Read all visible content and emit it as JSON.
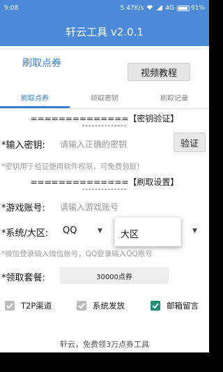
{
  "status_bar": {
    "time": "9:08",
    "speed": "5.47K/s",
    "network": "4G",
    "battery": "91%",
    "icons": [
      "wifi-icon",
      "signal-icon",
      "battery-icon"
    ]
  },
  "app_title": "轩云工具 v2.0.1",
  "top": {
    "title": "刷取点券",
    "tutorial_button": "视频教程"
  },
  "tabs": [
    {
      "label": "刷取点券",
      "active": true
    },
    {
      "label": "领取密钥",
      "active": false
    },
    {
      "label": "刷取记录",
      "active": false
    }
  ],
  "key_section": {
    "header": "==============【密钥验证】",
    "dashes": "--------------",
    "key_label": "*输入密钥:",
    "key_placeholder": "请输入正确的密钥",
    "verify_button": "验证",
    "hint": "*密钥用于验证使用软件权限，可免费领取!"
  },
  "settings_section": {
    "header": "==============【刷取设置】",
    "dashes": "--------------",
    "account_label": "*游戏账号:",
    "account_placeholder": "请输入游戏账号",
    "system_label": "*系统/大区:",
    "system_value": "QQ",
    "region_value": "大区",
    "hint": "*微信登录输入微信账号，QQ登录输入QQ账号",
    "package_label": "*领取套餐:",
    "package_value": "30000点券"
  },
  "options": [
    {
      "label": "T2P渠道",
      "checked": false
    },
    {
      "label": "系统发放",
      "checked": false
    },
    {
      "label": "邮箱留言",
      "checked": true
    }
  ],
  "footer": "轩云，免费领3万点券工具",
  "colors": {
    "primary": "#4a8ad8",
    "accent": "#3a80d8",
    "checkbox_on": "#1f8d78",
    "checkbox_off": "#bdbdbd"
  }
}
